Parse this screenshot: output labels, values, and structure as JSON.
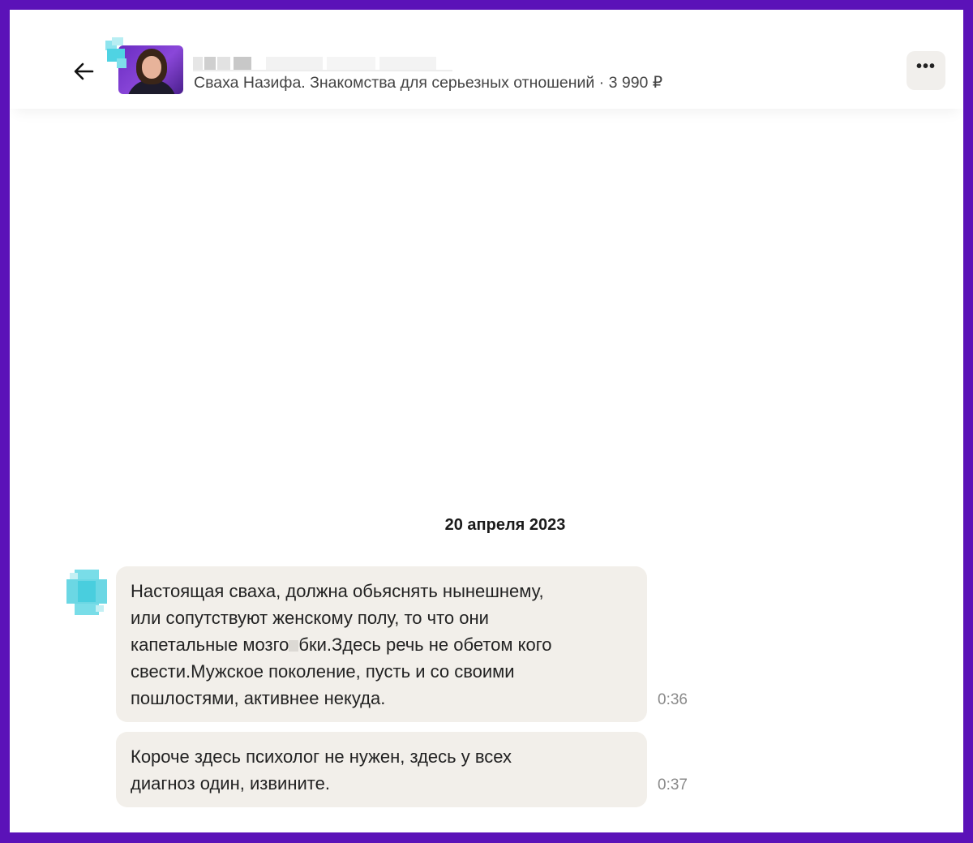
{
  "header": {
    "back_icon": "arrow-left-icon",
    "subtitle": "Сваха Назифа. Знакомства для серьезных отношений · 3 990 ₽",
    "more_icon": "more-horizontal-icon",
    "more_label": "•••"
  },
  "chat": {
    "date": "20 апреля 2023",
    "messages": [
      {
        "lines": [
          "Настоящая сваха, должна обьяснять нынешнему,",
          "или сопутствуют женскому полу, то что они",
          "капетальные мозго",
          "бки.Здесь речь не обетом кого",
          "свести.Мужское поколение, пусть и со своими",
          "пошлостями, активнее некуда."
        ],
        "time": "0:36"
      },
      {
        "lines": [
          "Короче здесь психолог не нужен, здесь у всех",
          "диагноз один, извините."
        ],
        "time": "0:37"
      }
    ]
  },
  "colors": {
    "frame_border": "#5b12b8",
    "bubble": "#f2efea",
    "time": "#8a8a8a"
  }
}
